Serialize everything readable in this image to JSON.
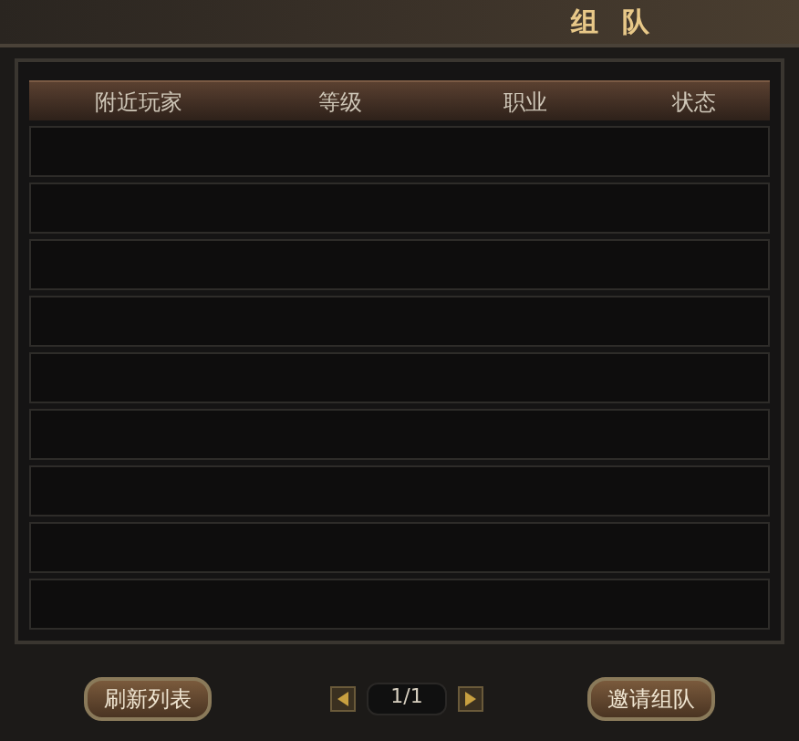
{
  "window": {
    "title": "组 队"
  },
  "table": {
    "columns": [
      "附近玩家",
      "等级",
      "职业",
      "状态"
    ]
  },
  "footer": {
    "refresh_button": "刷新列表",
    "page": "1/1",
    "invite_button": "邀请组队"
  }
}
